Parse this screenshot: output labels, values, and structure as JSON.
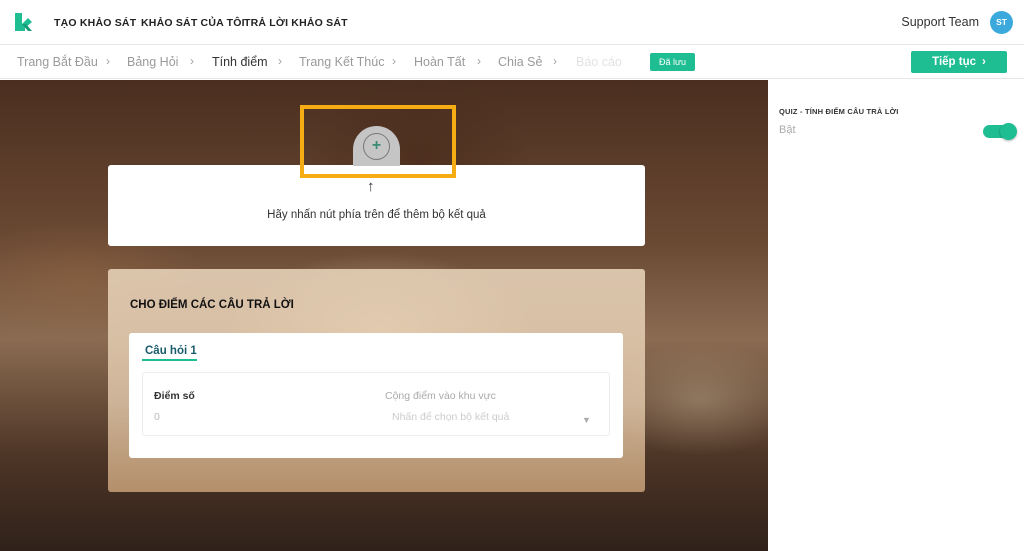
{
  "nav": {
    "items": [
      "TẠO KHẢO SÁT",
      "KHẢO SÁT CỦA TÔI",
      "TRẢ LỜI KHẢO SÁT"
    ],
    "user_name": "Support Team",
    "user_initials": "ST"
  },
  "stepper": {
    "steps": [
      "Trang Bắt Đầu",
      "Bảng Hỏi",
      "Tính điểm",
      "Trang Kết Thúc",
      "Hoàn Tất",
      "Chia Sẻ",
      "Báo cáo"
    ],
    "active_index": 2,
    "saved_label": "Đã lưu",
    "continue_label": "Tiếp tục",
    "chevron": "›"
  },
  "sidebar": {
    "title": "QUIZ - TÍNH ĐIỂM CÂU TRẢ LỜI",
    "status": "Bật",
    "toggle_on": true
  },
  "results": {
    "add_symbol": "+",
    "arrow": "↑",
    "hint": "Hãy nhấn nút phía trên để thêm bộ kết quả"
  },
  "scoring": {
    "title": "CHO ĐIỂM CÁC CÂU TRẢ LỜI",
    "question_tab": "Câu hỏi 1",
    "score_label": "Điểm số",
    "score_value": "0",
    "area_label": "Cộng điểm vào khu vực",
    "area_placeholder": "Nhấn để chọn bộ kết quả",
    "caret": "▼"
  },
  "colors": {
    "accent": "#1fbd92",
    "highlight": "#f6ad14",
    "avatar": "#3ba9dc"
  }
}
